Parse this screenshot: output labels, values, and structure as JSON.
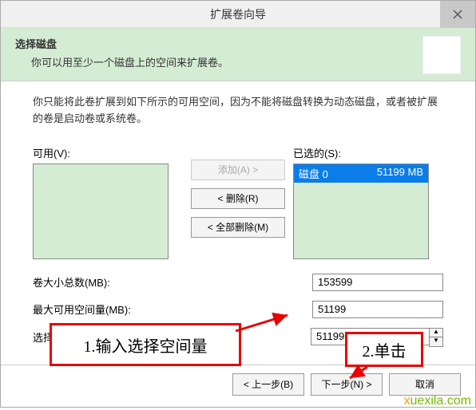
{
  "titlebar": {
    "title": "扩展卷向导"
  },
  "header": {
    "title": "选择磁盘",
    "subtitle": "你可以用至少一个磁盘上的空间来扩展卷。"
  },
  "description": "你只能将此卷扩展到如下所示的可用空间，因为不能将磁盘转换为动态磁盘，或者被扩展的卷是启动卷或系统卷。",
  "available": {
    "label": "可用(V):"
  },
  "selected": {
    "label": "已选的(S):",
    "item_name": "磁盘 0",
    "item_size": "51199 MB"
  },
  "buttons": {
    "add": "添加(A) >",
    "remove": "< 删除(R)",
    "remove_all": "< 全部删除(M)",
    "back": "< 上一步(B)",
    "next": "下一步(N) >",
    "cancel": "取消"
  },
  "fields": {
    "total_label": "卷大小总数(MB):",
    "total_value": "153599",
    "max_label": "最大可用空间量(MB):",
    "max_value": "51199",
    "select_label": "选择空间量(MB)(E):",
    "select_value": "51199"
  },
  "annotations": {
    "a1": "1.输入选择空间量",
    "a2": "2.单击"
  },
  "watermark": {
    "pre": "x",
    "rest": "uexila.com"
  }
}
